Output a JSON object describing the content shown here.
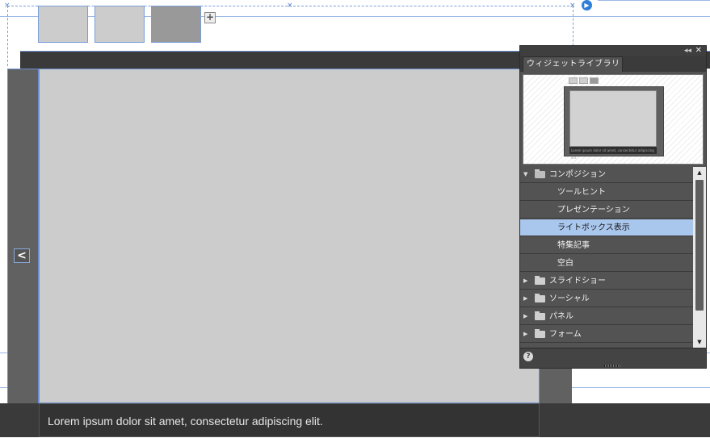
{
  "caption": {
    "text": "Lorem ipsum dolor sit amet, consectetur adipiscing elit."
  },
  "canvas": {
    "prev_glyph": "<",
    "add_glyph": "+"
  },
  "panel": {
    "tab_label": "ウィジェットライブラリ",
    "close_glyph": "✕",
    "collapse_glyph": "◂◂",
    "help_glyph": "?",
    "preview_caption": "Lorem ipsum dolor sit amet, consectetur adipiscing elit.",
    "tree": [
      {
        "label": "コンポジション",
        "expanded": true,
        "folder": true
      },
      {
        "label": "ツールヒント",
        "child": true
      },
      {
        "label": "プレゼンテーション",
        "child": true
      },
      {
        "label": "ライトボックス表示",
        "child": true,
        "selected": true
      },
      {
        "label": "特集記事",
        "child": true
      },
      {
        "label": "空白",
        "child": true
      },
      {
        "label": "スライドショー",
        "folder": true
      },
      {
        "label": "ソーシャル",
        "folder": true
      },
      {
        "label": "パネル",
        "folder": true
      },
      {
        "label": "フォーム",
        "folder": true
      }
    ]
  },
  "colors": {
    "selection": "#a9c6ec",
    "guide": "#7a9fd6",
    "panel_bg": "#535353"
  }
}
